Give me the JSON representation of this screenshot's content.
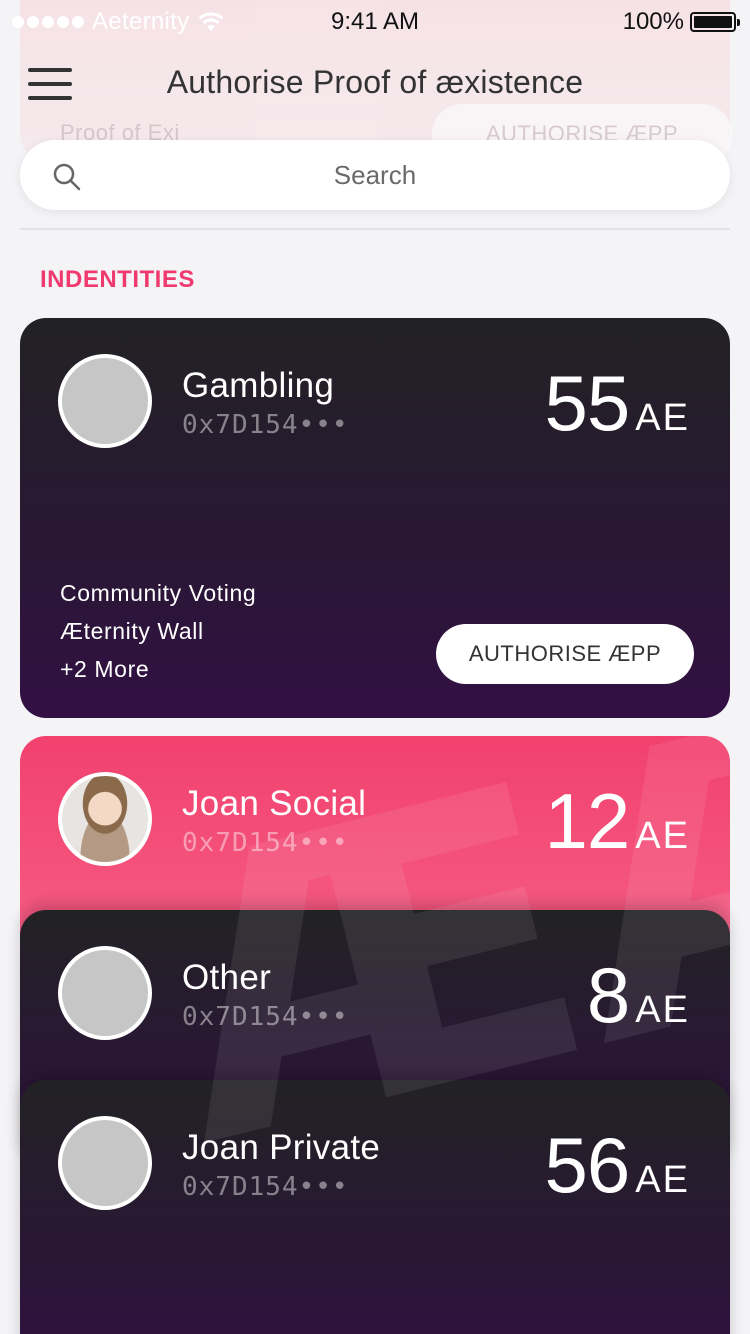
{
  "status_bar": {
    "carrier": "Aeternity",
    "time": "9:41 AM",
    "battery": "100%",
    "battery_level": 1.0
  },
  "header": {
    "title": "Authorise Proof of æxistence",
    "menu_icon": "hamburger-menu-icon",
    "background_card": {
      "label": "Proof of Exi",
      "button_label": "AUTHORISE ÆPP"
    }
  },
  "search": {
    "placeholder": "Search",
    "value": "",
    "icon": "search-icon"
  },
  "section": {
    "label": "INDENTITIES"
  },
  "identities": [
    {
      "name": "Gambling",
      "address": "0x7D154•••",
      "amount": "55",
      "unit": "AE",
      "permissions": [
        "Community Voting",
        "Æternity Wall",
        "+2 More"
      ],
      "button_label": "AUTHORISE ÆPP",
      "avatar": "placeholder"
    },
    {
      "name": "Joan Social",
      "address": "0x7D154•••",
      "amount": "12",
      "unit": "AE",
      "avatar": "photo"
    },
    {
      "name": "Other",
      "address": "0x7D154•••",
      "amount": "8",
      "unit": "AE",
      "avatar": "placeholder"
    },
    {
      "name": "Joan Private",
      "address": "0x7D154•••",
      "amount": "56",
      "unit": "AE",
      "avatar": "placeholder"
    }
  ],
  "watermark_glyph": "ÆÆ",
  "colors": {
    "accent": "#f0396f",
    "card_dark_top": "#222224",
    "card_dark_bottom": "#331044",
    "card_pink_top": "#f2416e",
    "card_pink_bottom": "#f56288",
    "background": "#f4f4f7"
  }
}
